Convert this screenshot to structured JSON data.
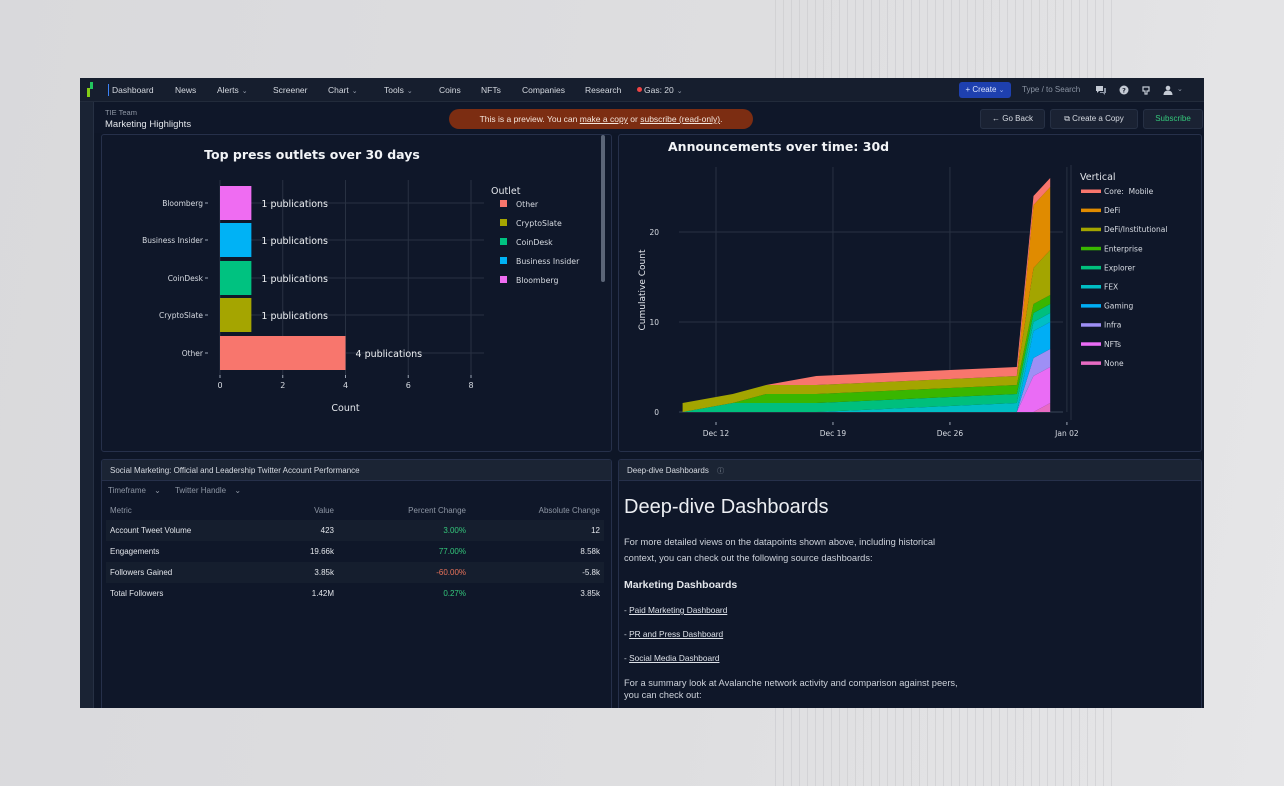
{
  "nav": {
    "items": [
      {
        "label": "Dashboard",
        "dropdown": false
      },
      {
        "label": "News",
        "dropdown": false
      },
      {
        "label": "Alerts",
        "dropdown": true
      },
      {
        "label": "Screener",
        "dropdown": false
      },
      {
        "label": "Chart",
        "dropdown": true
      },
      {
        "label": "Tools",
        "dropdown": true
      },
      {
        "label": "Coins",
        "dropdown": false
      },
      {
        "label": "NFTs",
        "dropdown": false
      },
      {
        "label": "Companies",
        "dropdown": false
      },
      {
        "label": "Research",
        "dropdown": false
      }
    ],
    "gas_label": "Gas: 20",
    "create_label": "+ Create",
    "search_placeholder": "Type / to Search",
    "icons": [
      "chat-icon",
      "help-icon",
      "announcement-icon",
      "user-icon"
    ]
  },
  "header": {
    "team": "TIE Team",
    "title": "Marketing Highlights",
    "banner": {
      "prefix": "This is a preview. You can ",
      "link1": "make a copy",
      "middle": " or ",
      "link2": "subscribe (read-only)",
      "suffix": "."
    },
    "go_back_label": "Go Back",
    "create_copy_label": "Create a Copy",
    "subscribe_label": "Subscribe"
  },
  "chart_data": [
    {
      "type": "bar",
      "orientation": "horizontal",
      "title": "Top press outlets over 30 days",
      "xlabel": "Count",
      "ylabel": "",
      "categories": [
        "Bloomberg",
        "Business Insider",
        "CoinDesk",
        "CryptoSlate",
        "Other"
      ],
      "values": [
        1,
        1,
        1,
        1,
        4
      ],
      "data_labels": [
        "1 publications",
        "1 publications",
        "1 publications",
        "1 publications",
        "4 publications"
      ],
      "colors": [
        "#EF6CF2",
        "#00B2F5",
        "#00C280",
        "#A5A500",
        "#F8766D"
      ],
      "xlim": [
        0,
        8
      ],
      "xticks": [
        0,
        2,
        4,
        6,
        8
      ],
      "grid": true,
      "legend": {
        "title": "Outlet",
        "placement": "right",
        "entries": [
          {
            "name": "Other",
            "color": "#F8766D"
          },
          {
            "name": "CryptoSlate",
            "color": "#A5A500"
          },
          {
            "name": "CoinDesk",
            "color": "#00C280"
          },
          {
            "name": "Business Insider",
            "color": "#00B2F5"
          },
          {
            "name": "Bloomberg",
            "color": "#EF6CF2"
          }
        ]
      }
    },
    {
      "type": "area",
      "stacked": true,
      "title": "Announcements over time: 30d",
      "xlabel": "",
      "ylabel": "Cumulative Count",
      "x": [
        "Dec 10",
        "Dec 13",
        "Dec 15",
        "Dec 18",
        "Dec 30",
        "Dec 31",
        "Jan 01"
      ],
      "x_day_offsets": [
        -2,
        1,
        3,
        6,
        18,
        19,
        20
      ],
      "xticks": [
        {
          "label": "Dec 12",
          "day": 0
        },
        {
          "label": "Dec 19",
          "day": 7
        },
        {
          "label": "Dec 26",
          "day": 14
        },
        {
          "label": "Jan 02",
          "day": 21
        }
      ],
      "ylim": [
        0,
        27
      ],
      "yticks": [
        0,
        10,
        20
      ],
      "grid": true,
      "series": [
        {
          "name": "None",
          "color": "#E76BC3",
          "values": [
            0,
            0,
            0,
            0,
            0,
            0,
            1
          ]
        },
        {
          "name": "NFTs",
          "color": "#EA6CF5",
          "values": [
            0,
            0,
            0,
            0,
            0,
            4,
            4
          ]
        },
        {
          "name": "Infra",
          "color": "#9E8FF5",
          "values": [
            0,
            0,
            0,
            0,
            0,
            2,
            2
          ]
        },
        {
          "name": "Gaming",
          "color": "#00AEF5",
          "values": [
            0,
            0,
            0,
            0,
            0,
            3,
            3
          ]
        },
        {
          "name": "FEX",
          "color": "#00BEC4",
          "values": [
            0,
            0,
            0,
            0,
            1,
            1,
            1
          ]
        },
        {
          "name": "Explorer",
          "color": "#00BF7D",
          "values": [
            0,
            1,
            1,
            1,
            1,
            1,
            1
          ]
        },
        {
          "name": "Enterprise",
          "color": "#39B600",
          "values": [
            0,
            0,
            1,
            1,
            1,
            1,
            1
          ]
        },
        {
          "name": "DeFi/Institutional",
          "color": "#A3A500",
          "values": [
            1,
            1,
            1,
            1,
            1,
            4,
            5
          ]
        },
        {
          "name": "DeFi",
          "color": "#E08B00",
          "values": [
            0,
            0,
            0,
            0,
            0,
            7,
            7
          ]
        },
        {
          "name": "Core:  Mobile",
          "color": "#F8766D",
          "values": [
            0,
            0,
            0,
            1,
            1,
            1,
            1
          ]
        }
      ],
      "legend": {
        "title": "Vertical",
        "placement": "right"
      }
    }
  ],
  "social_table": {
    "title": "Social Marketing: Official and Leadership Twitter Account Performance",
    "filters": [
      "Timeframe",
      "Twitter Handle"
    ],
    "columns": [
      "Metric",
      "Value",
      "Percent Change",
      "Absolute Change"
    ],
    "rows": [
      {
        "metric": "Account Tweet Volume",
        "value": "423",
        "pct": "3.00%",
        "pct_dir": "pos",
        "abs": "12"
      },
      {
        "metric": "Engagements",
        "value": "19.66k",
        "pct": "77.00%",
        "pct_dir": "pos",
        "abs": "8.58k"
      },
      {
        "metric": "Followers Gained",
        "value": "3.85k",
        "pct": "-60.00%",
        "pct_dir": "neg",
        "abs": "-5.8k"
      },
      {
        "metric": "Total Followers",
        "value": "1.42M",
        "pct": "0.27%",
        "pct_dir": "pos",
        "abs": "3.85k"
      }
    ]
  },
  "deep_dive": {
    "panel_title": "Deep-dive Dashboards",
    "heading": "Deep-dive Dashboards",
    "intro": "For more detailed views on the datapoints shown above, including historical context, you can check out the following source dashboards:",
    "subheading": "Marketing Dashboards",
    "links": [
      "Paid Marketing Dashboard",
      "PR and Press Dashboard",
      "Social Media Dashboard"
    ],
    "outro": "For a summary look at Avalanche network activity and comparison against peers, you can check out:"
  },
  "colors": {
    "app_bg": "#0E1627",
    "banner": "#7C2D12",
    "create_button": "#1E40AF",
    "subscribe_text": "#34C77B",
    "positive": "#34C77B",
    "negative": "#E9735A"
  }
}
